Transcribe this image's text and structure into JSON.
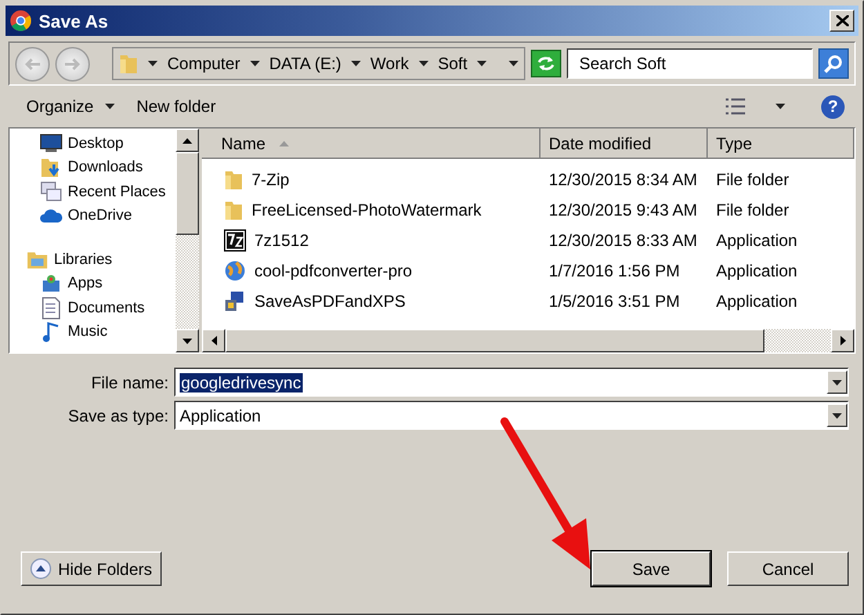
{
  "window": {
    "title": "Save As"
  },
  "address": {
    "crumbs": [
      "Computer",
      "DATA (E:)",
      "Work",
      "Soft"
    ]
  },
  "search": {
    "placeholder": "Search Soft"
  },
  "toolbar": {
    "organize": "Organize",
    "new_folder": "New folder",
    "help": "?"
  },
  "sidebar": {
    "items": [
      {
        "label": "Desktop"
      },
      {
        "label": "Downloads"
      },
      {
        "label": "Recent Places"
      },
      {
        "label": "OneDrive"
      },
      {
        "label": "Libraries",
        "children": [
          {
            "label": "Apps"
          },
          {
            "label": "Documents"
          },
          {
            "label": "Music"
          }
        ]
      }
    ]
  },
  "table": {
    "columns": [
      "Name",
      "Date modified",
      "Type"
    ],
    "rows": [
      {
        "name": "7-Zip",
        "date": "12/30/2015 8:34 AM",
        "type": "File folder"
      },
      {
        "name": "FreeLicensed-PhotoWatermark",
        "date": "12/30/2015 9:43 AM",
        "type": "File folder"
      },
      {
        "name": "7z1512",
        "date": "12/30/2015 8:33 AM",
        "type": "Application"
      },
      {
        "name": "cool-pdfconverter-pro",
        "date": "1/7/2016 1:56 PM",
        "type": "Application"
      },
      {
        "name": "SaveAsPDFandXPS",
        "date": "1/5/2016 3:51 PM",
        "type": "Application"
      }
    ]
  },
  "form": {
    "file_name": {
      "label": "File name:",
      "value": "googledrivesync"
    },
    "save_as_type": {
      "label": "Save as type:",
      "value": "Application"
    }
  },
  "buttons": {
    "hide_folders": "Hide Folders",
    "save": "Save",
    "cancel": "Cancel"
  }
}
